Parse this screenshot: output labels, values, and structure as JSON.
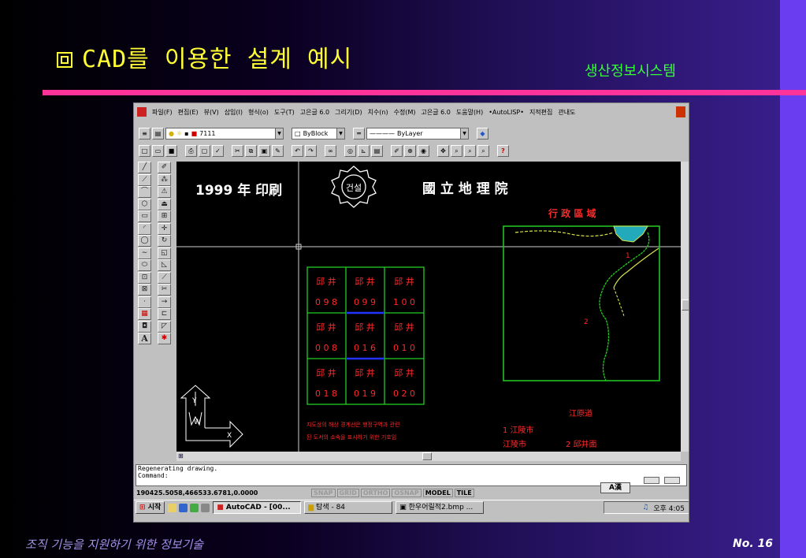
{
  "slide": {
    "title": "CAD를 이용한 설계 예시",
    "subtitle": "생산정보시스템",
    "footer_left": "조직 기능을 지원하기 위한 정보기술",
    "footer_right": "No. 16"
  },
  "cad": {
    "menu_items": [
      "파일(F)",
      "편집(E)",
      "뷰(V)",
      "삽입(I)",
      "형식(o)",
      "도구(T)",
      "고은글 6.0",
      "그리기(D)",
      "치수(n)",
      "수정(M)",
      "고은글 6.0",
      "도움말(H)",
      "•AutoLISP•",
      "지적편집",
      "관내도"
    ],
    "layer_value": "7111",
    "color_value": "ByBlock",
    "linetype_value": "ByLayer",
    "drawing": {
      "header_year": "1999 年 印刷",
      "header_institute": "國 立 地 理 院",
      "seal_text": "건설",
      "region_title": "行 政 區 域",
      "grid_cells": [
        [
          "邱 井",
          "邱 井",
          "邱 井"
        ],
        [
          "0 9 8",
          "0 9 9",
          "1 0 0"
        ],
        [
          "邱 井",
          "邱 井",
          "邱 井"
        ],
        [
          "0 0 8",
          "0 1 6",
          "0 1 0"
        ],
        [
          "邱 井",
          "邱 井",
          "邱 井"
        ],
        [
          "0 1 8",
          "0 1 9",
          "0 2 0"
        ]
      ],
      "note_line1": "지도상의 해상 경계선은 행정구역과 관련",
      "note_line2": "된 도서의 소속을 표시하기 위한 기호임",
      "region_label_1": "1",
      "region_label_2": "2",
      "legend_province": "江原道",
      "legend_item1": "1 江陵市",
      "legend_city": "江陵市",
      "legend_item2": "2 邱井面",
      "ucs_y": "Y",
      "ucs_w": "W",
      "ucs_x": "X"
    },
    "command_lines": [
      "Regenerating drawing.",
      "Command:"
    ],
    "status": {
      "coords": "190425.5058,466533.6781,0.0000",
      "modes": [
        {
          "label": "SNAP",
          "on": false
        },
        {
          "label": "GRID",
          "on": false
        },
        {
          "label": "ORTHO",
          "on": false
        },
        {
          "label": "OSNAP",
          "on": false
        },
        {
          "label": "MODEL",
          "on": true
        },
        {
          "label": "TILE",
          "on": true
        }
      ],
      "ime_label": "A漢"
    },
    "taskbar": {
      "start_label": "시작",
      "tasks": [
        "AutoCAD - [00...",
        "탐색 - 84",
        "한우어릴적2.bmp ..."
      ],
      "clock": "오후 4:05"
    }
  },
  "colors": {
    "title_yellow": "#ffff33",
    "subtitle_green": "#33ff33",
    "rule_pink": "#ff3399",
    "cad_green": "#22cc22",
    "cad_red": "#ff2a2a",
    "cad_yellow_green": "#d9e64a",
    "cad_cyan": "#22aabb"
  }
}
